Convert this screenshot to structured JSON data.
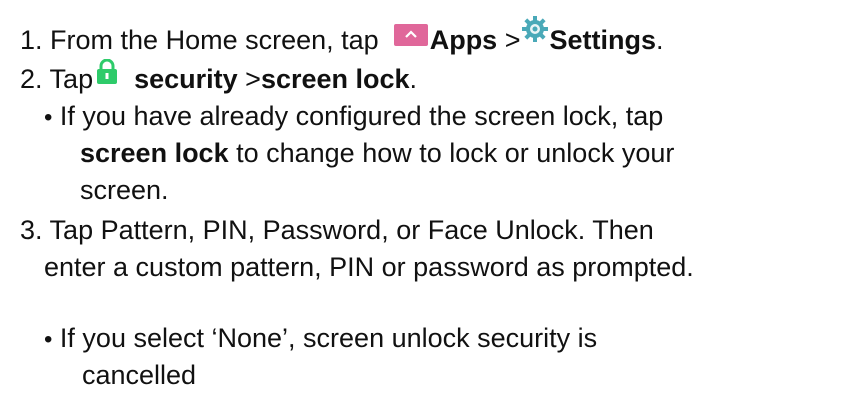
{
  "steps": [
    {
      "num": "1.",
      "pre": "From the Home screen, tap",
      "apps_label": "Apps",
      "sep": ">",
      "settings_label": "Settings",
      "end": "."
    },
    {
      "num": "2.",
      "pre": "Tap",
      "security_label": "security",
      "sep": ">",
      "screenlock_label": "screen lock",
      "end": "."
    },
    {
      "num": "3.",
      "line1": "Tap Pattern, PIN, Password, or Face Unlock. Then",
      "line2": "enter a custom pattern, PIN or password as prompted."
    }
  ],
  "notes": {
    "configured": {
      "bullet": "•",
      "line1": "If you have already configured the screen lock, tap",
      "bold": "screen lock",
      "line2_rest": " to change how to lock or unlock your",
      "line3": "screen."
    },
    "none": {
      "bullet": "•",
      "line1": "If you select ‘None’, screen unlock security is",
      "line2": "cancelled"
    }
  },
  "icons": {
    "apps": "chevron-up-icon",
    "settings": "gear-icon",
    "security": "lock-icon"
  },
  "colors": {
    "apps_icon_bg": "#e0679a",
    "lock_green": "#2ecb6a",
    "gear_teal": "#4aa9b8"
  }
}
